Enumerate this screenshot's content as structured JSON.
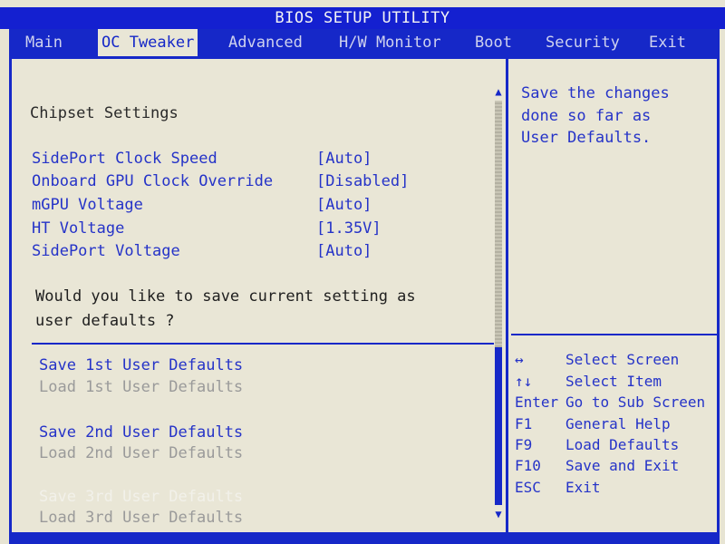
{
  "title": "BIOS SETUP UTILITY",
  "menu": [
    "Main",
    "OC Tweaker",
    "Advanced",
    "H/W Monitor",
    "Boot",
    "Security",
    "Exit"
  ],
  "section_title": "Chipset Settings",
  "settings": [
    {
      "label": "SidePort Clock Speed",
      "value": "[Auto]"
    },
    {
      "label": "Onboard GPU Clock Override",
      "value": "[Disabled]"
    },
    {
      "label": "mGPU Voltage",
      "value": "[Auto]"
    },
    {
      "label": "HT Voltage",
      "value": "[1.35V]"
    },
    {
      "label": "SidePort Voltage",
      "value": "[Auto]"
    }
  ],
  "question": [
    "Would you like to save current setting as",
    "user defaults ?"
  ],
  "actions": [
    {
      "label": "Save 1st User Defaults",
      "state": "enabled"
    },
    {
      "label": "Load 1st User Defaults",
      "state": "disabled"
    },
    {
      "label": "Save 2nd User Defaults",
      "state": "enabled"
    },
    {
      "label": "Load 2nd User Defaults",
      "state": "disabled"
    },
    {
      "label": "Save 3rd User Defaults",
      "state": "selected"
    },
    {
      "label": "Load 3rd User Defaults",
      "state": "disabled"
    }
  ],
  "help_text": [
    "Save the changes",
    "done so far as",
    "User Defaults."
  ],
  "keys": [
    {
      "key": "↔",
      "desc": "Select Screen"
    },
    {
      "key": "↑↓",
      "desc": "Select Item"
    },
    {
      "key": "Enter",
      "desc": "Go to Sub Screen"
    },
    {
      "key": "F1",
      "desc": "General Help"
    },
    {
      "key": "F9",
      "desc": "Load Defaults"
    },
    {
      "key": "F10",
      "desc": "Save and Exit"
    },
    {
      "key": "ESC",
      "desc": "Exit"
    }
  ],
  "scroll_arrows": {
    "up": "▲",
    "down": "▼"
  },
  "colors": {
    "bios_blue": "#1628c8",
    "panel_bg": "#e9e6d6",
    "text_blue": "#2533c8",
    "disabled_gray": "#9a9a9a"
  }
}
